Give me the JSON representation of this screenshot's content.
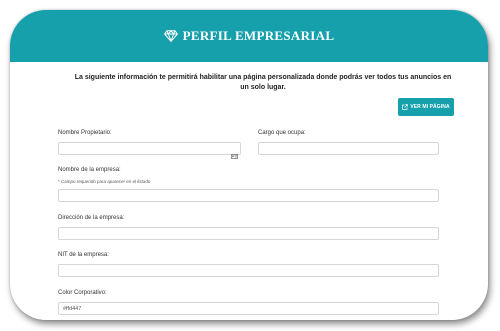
{
  "header": {
    "title": "PERFIL EMPRESARIAL",
    "icon": "diamond-icon"
  },
  "intro": {
    "text": "La siguiente información te permitirá habilitar una página personalizada donde podrás ver todos tus anuncios en un solo lugar."
  },
  "page_button": {
    "label": "VER MI PÁGINA",
    "icon": "external-link-icon"
  },
  "form": {
    "owner_name": {
      "label": "Nombre Propietario:",
      "value": "",
      "icon": "id-card-icon"
    },
    "position": {
      "label": "Cargo que ocupa:",
      "value": ""
    },
    "company_name": {
      "label": "Nombre de la empresa:",
      "required_hint": "Campo requerido para aparecer en el listado",
      "value": ""
    },
    "company_address": {
      "label": "Dirección de la empresa:",
      "value": ""
    },
    "company_nit": {
      "label": "NIT de la empresa:",
      "value": ""
    },
    "corporate_color": {
      "label": "Color Corporativo:",
      "value": "#ffd447"
    }
  },
  "colors": {
    "accent": "#16a0ac",
    "required": "#e53935",
    "border": "#d6d6d6"
  }
}
